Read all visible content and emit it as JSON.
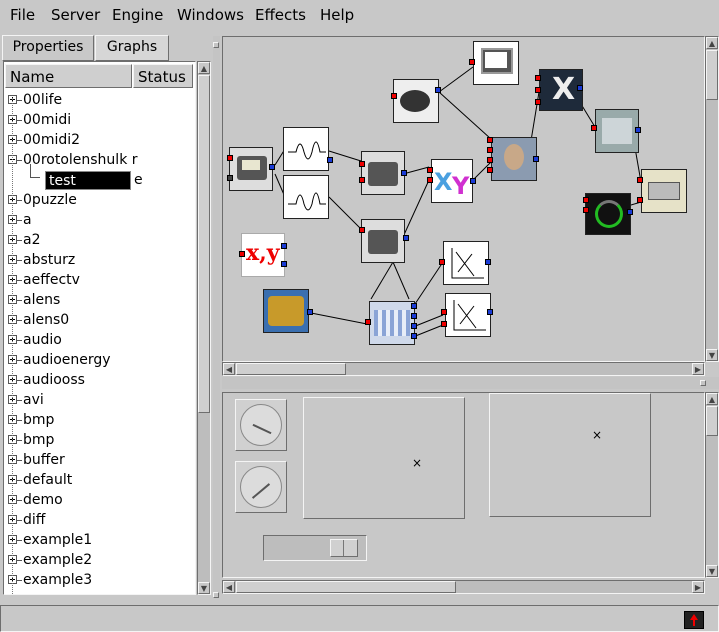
{
  "menu": [
    "File",
    "Server",
    "Engine",
    "Windows",
    "Effects",
    "Help"
  ],
  "tabs": {
    "properties": "Properties",
    "graphs": "Graphs"
  },
  "tree": {
    "headers": {
      "name": "Name",
      "status": "Status"
    },
    "items": [
      {
        "label": "00life",
        "expander": "plus"
      },
      {
        "label": "00midi",
        "expander": "plus"
      },
      {
        "label": "00midi2",
        "expander": "plus"
      },
      {
        "label": "00rotolenshulk r",
        "expander": "minus"
      },
      {
        "label": "test",
        "child": true,
        "status": "e"
      },
      {
        "label": "0puzzle",
        "expander": "plus"
      },
      {
        "label": "a",
        "expander": "plus"
      },
      {
        "label": "a2",
        "expander": "plus"
      },
      {
        "label": "absturz",
        "expander": "plus"
      },
      {
        "label": "aeffectv",
        "expander": "plus"
      },
      {
        "label": "alens",
        "expander": "plus"
      },
      {
        "label": "alens0",
        "expander": "plus"
      },
      {
        "label": "audio",
        "expander": "plus"
      },
      {
        "label": "audioenergy",
        "expander": "plus"
      },
      {
        "label": "audiooss",
        "expander": "plus"
      },
      {
        "label": "avi",
        "expander": "plus"
      },
      {
        "label": "bmp",
        "expander": "plus"
      },
      {
        "label": "bmp",
        "expander": "plus"
      },
      {
        "label": "buffer",
        "expander": "plus"
      },
      {
        "label": "default",
        "expander": "plus"
      },
      {
        "label": "demo",
        "expander": "plus"
      },
      {
        "label": "diff",
        "expander": "plus"
      },
      {
        "label": "example1",
        "expander": "plus"
      },
      {
        "label": "example2",
        "expander": "plus"
      },
      {
        "label": "example3",
        "expander": "plus"
      }
    ]
  },
  "graph": {
    "xy_label": "x,y",
    "nodes": [
      "clock",
      "clock",
      "wave",
      "wave",
      "clock",
      "xy-mixer",
      "tape",
      "monitor",
      "clock",
      "xy-text",
      "face-video",
      "x-glyph",
      "office-photo",
      "gauge",
      "pager",
      "amplifier",
      "slider-bank",
      "plot",
      "plot"
    ]
  },
  "lower": {
    "xy_marker": "×",
    "xy_marker2": "×"
  },
  "colors": {
    "accent_red": "#e00000",
    "accent_blue": "#1a3bd6",
    "panel": "#c8c8c8"
  }
}
